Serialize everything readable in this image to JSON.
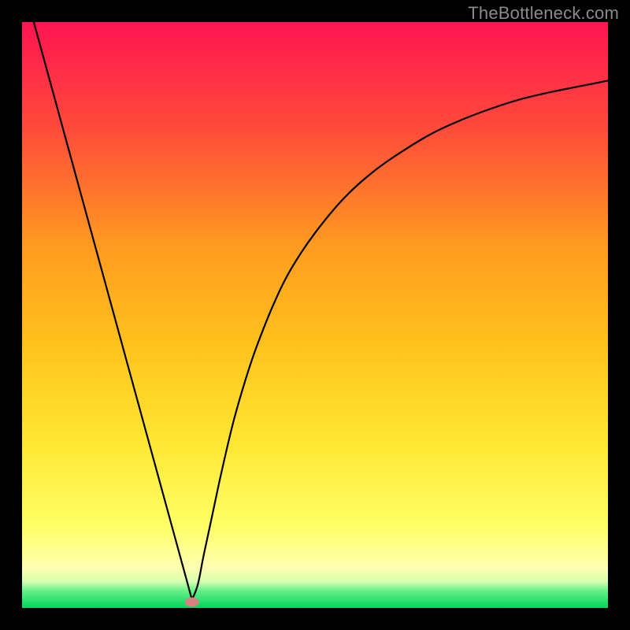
{
  "watermark": "TheBottleneck.com",
  "chart_data": {
    "type": "line",
    "title": "",
    "xlabel": "",
    "ylabel": "",
    "xlim": [
      0,
      100
    ],
    "ylim": [
      0,
      100
    ],
    "grid": false,
    "legend": false,
    "gradient_colors": {
      "top": "#ff1452",
      "upper_mid": "#ff7a2a",
      "mid": "#ffb018",
      "lower_mid": "#ffe033",
      "pale": "#ffff9d",
      "green_band": "#00e756",
      "bottom_line": "#00c853"
    },
    "marker": {
      "x": 29.0,
      "y": 1.0,
      "color_hex": "#d98080",
      "shape": "ellipse"
    },
    "series": [
      {
        "name": "curve",
        "color_hex": "#000000",
        "x": [
          2.0,
          4.0,
          6.0,
          8.0,
          10.0,
          12.0,
          14.0,
          16.0,
          18.0,
          20.0,
          22.0,
          24.0,
          26.0,
          28.0,
          29.0,
          30.0,
          31.0,
          32.5,
          34.0,
          36.0,
          38.0,
          40.0,
          43.0,
          46.0,
          50.0,
          55.0,
          60.0,
          65.0,
          70.0,
          75.0,
          80.0,
          85.0,
          90.0,
          95.0,
          100.0
        ],
        "y": [
          100.0,
          92.7,
          85.4,
          78.1,
          70.8,
          63.5,
          56.2,
          48.9,
          41.6,
          34.3,
          27.0,
          19.7,
          12.4,
          5.1,
          1.4,
          4.0,
          9.0,
          16.0,
          23.0,
          31.5,
          38.5,
          44.5,
          52.0,
          58.0,
          64.0,
          70.0,
          74.5,
          78.0,
          81.0,
          83.3,
          85.2,
          86.8,
          88.0,
          89.0,
          90.0
        ]
      }
    ]
  }
}
